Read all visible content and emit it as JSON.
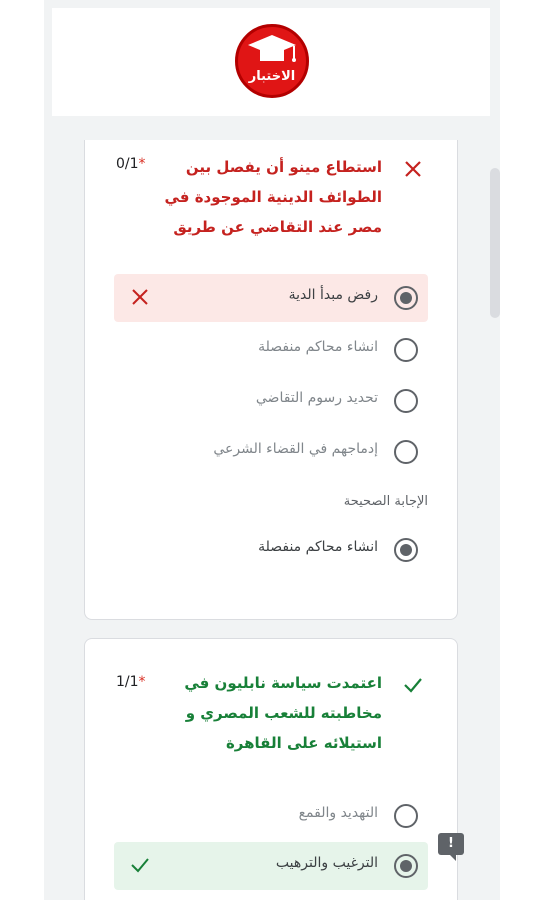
{
  "header": {
    "logo_text": "الاختبار"
  },
  "questions": [
    {
      "text": "استطاع مينو أن يفصل بين الطوائف الدينية الموجودة في مصر عند التقاضي عن طريق",
      "score": "0/1",
      "required": "*",
      "status": "wrong",
      "options": [
        {
          "label": "رفض مبدأ الدية",
          "selected": true,
          "result": "wrong"
        },
        {
          "label": "انشاء محاكم منفصلة",
          "selected": false
        },
        {
          "label": "تحديد رسوم التقاضي",
          "selected": false
        },
        {
          "label": "إدماجهم في القضاء الشرعي",
          "selected": false
        }
      ],
      "correct_heading": "الإجابة الصحيحة",
      "correct_answer": "انشاء محاكم منفصلة"
    },
    {
      "text": "اعتمدت سياسة نابليون في مخاطبته للشعب المصري و استيلائه على القاهرة",
      "score": "1/1",
      "required": "*",
      "status": "right",
      "options": [
        {
          "label": "التهديد والقمع",
          "selected": false
        },
        {
          "label": "الترغيب والترهيب",
          "selected": true,
          "result": "right"
        }
      ]
    }
  ],
  "report_icon": "!",
  "colors": {
    "wrong": "#c5221f",
    "right": "#188038",
    "wrong_bg": "#fce8e6",
    "right_bg": "#e6f4ea",
    "logo_red": "#e01515"
  },
  "icons": {
    "wrong_mark": "close-icon",
    "right_mark": "check-icon",
    "report": "report-problem-icon"
  }
}
